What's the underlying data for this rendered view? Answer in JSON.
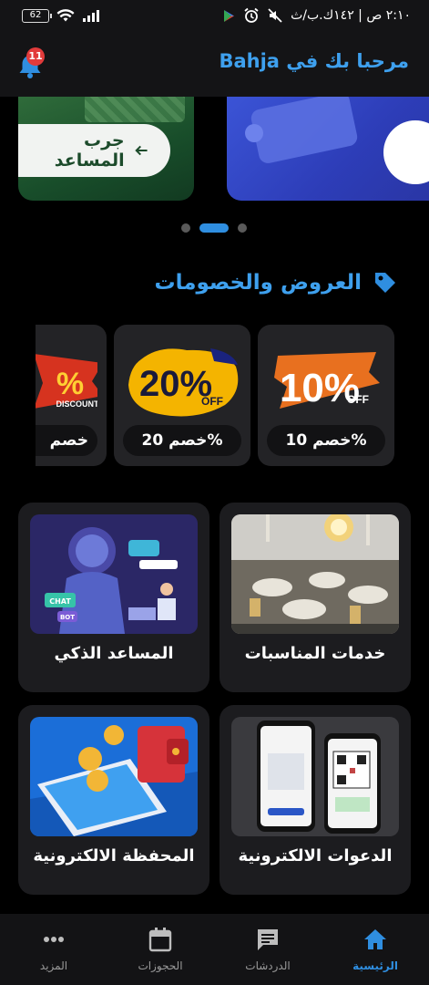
{
  "status_bar": {
    "battery": "62",
    "time": "٢:١٠ ص | ١٤٢ك.ب/ث"
  },
  "header": {
    "welcome": "مرحبا بك في Bahja",
    "notification_count": "11"
  },
  "carousel": {
    "slide_1_button": "جرب المساعد",
    "active_index": 1,
    "total": 3
  },
  "offers": {
    "title": "العروض والخصومات",
    "items": [
      {
        "label": "خصم 10%",
        "graphic_text": "10%",
        "graphic_sub": "OFF"
      },
      {
        "label": "خصم 20%",
        "graphic_text": "20%",
        "graphic_sub": "OFF"
      },
      {
        "label": "خصم",
        "graphic_text": "%",
        "graphic_sub": "DISCOUNT"
      }
    ]
  },
  "services": [
    {
      "label": "خدمات المناسبات",
      "icon": "event-hall-image"
    },
    {
      "label": "المساعد الذكي",
      "icon": "ai-robot-image",
      "badge_1": "CHAT",
      "badge_2": "BOT"
    },
    {
      "label": "الدعوات الالكترونية",
      "icon": "invitation-phones-image"
    },
    {
      "label": "المحفظة الالكترونية",
      "icon": "wallet-phone-image"
    }
  ],
  "bottom_nav": [
    {
      "label": "الرئيسية",
      "icon": "home-icon",
      "active": true
    },
    {
      "label": "الدردشات",
      "icon": "chat-icon",
      "active": false
    },
    {
      "label": "الحجوزات",
      "icon": "calendar-icon",
      "active": false
    },
    {
      "label": "المزيد",
      "icon": "more-icon",
      "active": false
    }
  ],
  "colors": {
    "accent": "#3ea0ee",
    "badge": "#e23b3b",
    "background": "#000000",
    "card": "#1c1c1f"
  }
}
